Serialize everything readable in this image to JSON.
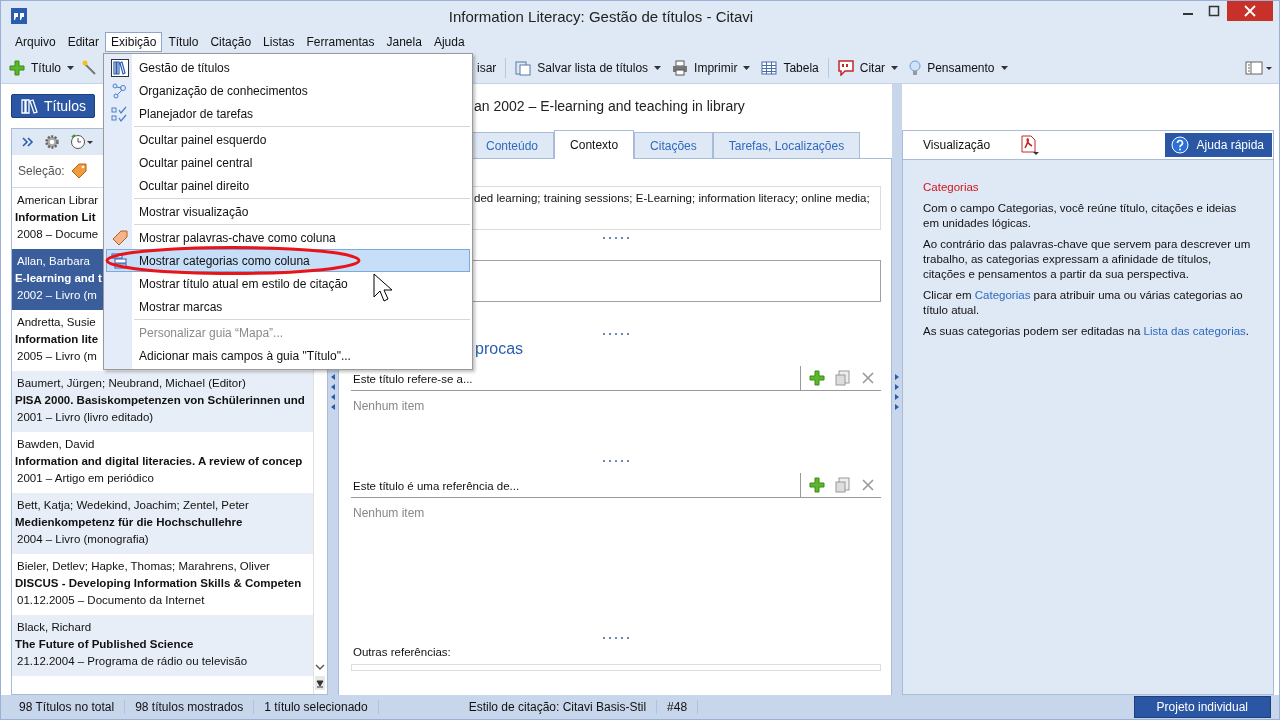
{
  "window": {
    "title": "Information Literacy: Gestão de títulos - Citavi"
  },
  "menubar": [
    {
      "label": "Arquivo",
      "selected": false
    },
    {
      "label": "Editar",
      "selected": false
    },
    {
      "label": "Exibição",
      "selected": true
    },
    {
      "label": "Título",
      "selected": false
    },
    {
      "label": "Citação",
      "selected": false
    },
    {
      "label": "Listas",
      "selected": false
    },
    {
      "label": "Ferramentas",
      "selected": false
    },
    {
      "label": "Janela",
      "selected": false
    },
    {
      "label": "Ajuda",
      "selected": false
    }
  ],
  "toolbar": {
    "left": [
      {
        "label": "Título",
        "dropdown": true
      }
    ],
    "right": [
      {
        "label": "isar",
        "dropdown": false
      },
      {
        "label": "Salvar lista de títulos",
        "dropdown": true
      },
      {
        "label": "Imprimir",
        "dropdown": true
      },
      {
        "label": "Tabela",
        "dropdown": false
      },
      {
        "label": "Citar",
        "dropdown": true
      },
      {
        "label": "Pensamento",
        "dropdown": true
      }
    ]
  },
  "view_button": {
    "label": "Títulos",
    "selected": true
  },
  "selection_label": "Seleção:",
  "titles": [
    {
      "authors": "American Librar",
      "title": "Information Lit",
      "info": "2008 – Docume",
      "selected": false
    },
    {
      "authors": "Allan, Barbara",
      "title": "E-learning and t",
      "info": "2002 – Livro (m",
      "selected": true
    },
    {
      "authors": "Andretta, Susie",
      "title": "Information lite",
      "info": "2005 – Livro (m",
      "selected": false
    },
    {
      "authors": "Baumert, Jürgen; Neubrand, Michael (Editor)",
      "title": "PISA 2000. Basiskompetenzen von Schülerinnen und",
      "info": "2001 – Livro (livro editado)",
      "selected": false
    },
    {
      "authors": "Bawden, David",
      "title": "Information and digital literacies. A review of concep",
      "info": "2001 – Artigo em periódico",
      "selected": false
    },
    {
      "authors": "Bett, Katja; Wedekind, Joachim; Zentel, Peter",
      "title": "Medienkompetenz für die Hochschullehre",
      "info": "2004 – Livro (monografia)",
      "selected": false
    },
    {
      "authors": "Bieler, Detlev; Hapke, Thomas; Marahrens, Oliver",
      "title": "DISCUS - Developing Information Skills & Competen",
      "info": "01.12.2005 – Documento da Internet",
      "selected": false
    },
    {
      "authors": "Black, Richard",
      "title": "The Future of Published Science",
      "info": "21.12.2004 – Programa de rádio ou televisão",
      "selected": false
    }
  ],
  "center": {
    "heading": "an 2002 – E-learning and teaching in library",
    "tabs": [
      {
        "label": "Conteúdo",
        "selected": false
      },
      {
        "label": "Contexto",
        "selected": true
      },
      {
        "label": "Citações",
        "selected": false
      },
      {
        "label": "Tarefas, Localizações",
        "selected": false
      }
    ],
    "keywords": "ded learning; training sessions; E-Learning; information literacy; online media;",
    "section_heading": "procas",
    "lists": [
      {
        "header": "Este título refere-se a...",
        "empty": "Nenhum item"
      },
      {
        "header": "Este título é uma referência de...",
        "empty": "Nenhum item"
      }
    ],
    "other_label": "Outras referências:"
  },
  "right": {
    "tab": "Visualização",
    "help_button": "Ajuda rápida",
    "heading": "Categorias",
    "paragraphs": [
      [
        {
          "kind": "text",
          "text": "Com o campo Categorias, você reúne título, citações e ideias em unidades lógicas."
        }
      ],
      [
        {
          "kind": "text",
          "text": "Ao contrário das palavras-chave que servem para descrever um trabalho, as categorias expressam a afinidade de títulos, citações e pensamentos a partir da sua perspectiva."
        }
      ],
      [
        {
          "kind": "text",
          "text": "Clicar em "
        },
        {
          "kind": "link",
          "text": "Categorias"
        },
        {
          "kind": "text",
          "text": " para atribuir uma ou várias categorias ao título atual."
        }
      ],
      [
        {
          "kind": "text",
          "text": "As suas categorias podem ser editadas na "
        },
        {
          "kind": "link",
          "text": "Lista das categorias"
        },
        {
          "kind": "text",
          "text": "."
        }
      ]
    ]
  },
  "menu": {
    "groups": [
      [
        {
          "label": "Gestão de títulos",
          "selected": false,
          "disabled": false
        },
        {
          "label": "Organização de conhecimentos",
          "selected": false,
          "disabled": false
        },
        {
          "label": "Planejador de tarefas",
          "selected": false,
          "disabled": false
        }
      ],
      [
        {
          "label": "Ocultar painel esquerdo",
          "selected": false,
          "disabled": false
        },
        {
          "label": "Ocultar painel central",
          "selected": false,
          "disabled": false
        },
        {
          "label": "Ocultar painel direito",
          "selected": false,
          "disabled": false
        }
      ],
      [
        {
          "label": "Mostrar visualização",
          "selected": false,
          "disabled": false
        }
      ],
      [
        {
          "label": "Mostrar palavras-chave como coluna",
          "selected": false,
          "disabled": false
        },
        {
          "label": "Mostrar categorias como coluna",
          "selected": true,
          "disabled": false
        },
        {
          "label": "Mostrar título atual em estilo de citação",
          "selected": false,
          "disabled": false
        },
        {
          "label": "Mostrar marcas",
          "selected": false,
          "disabled": false
        }
      ],
      [
        {
          "label": "Personalizar guia “Mapa”...",
          "selected": false,
          "disabled": true
        },
        {
          "label": "Adicionar mais campos à guia \"Título\"...",
          "selected": false,
          "disabled": false
        }
      ]
    ]
  },
  "status": [
    "98 Títulos no total",
    "98 títulos mostrados",
    "1 título selecionado",
    "Estilo de citação: Citavi Basis-Stil",
    "#48"
  ],
  "status_button": "Projeto individual"
}
